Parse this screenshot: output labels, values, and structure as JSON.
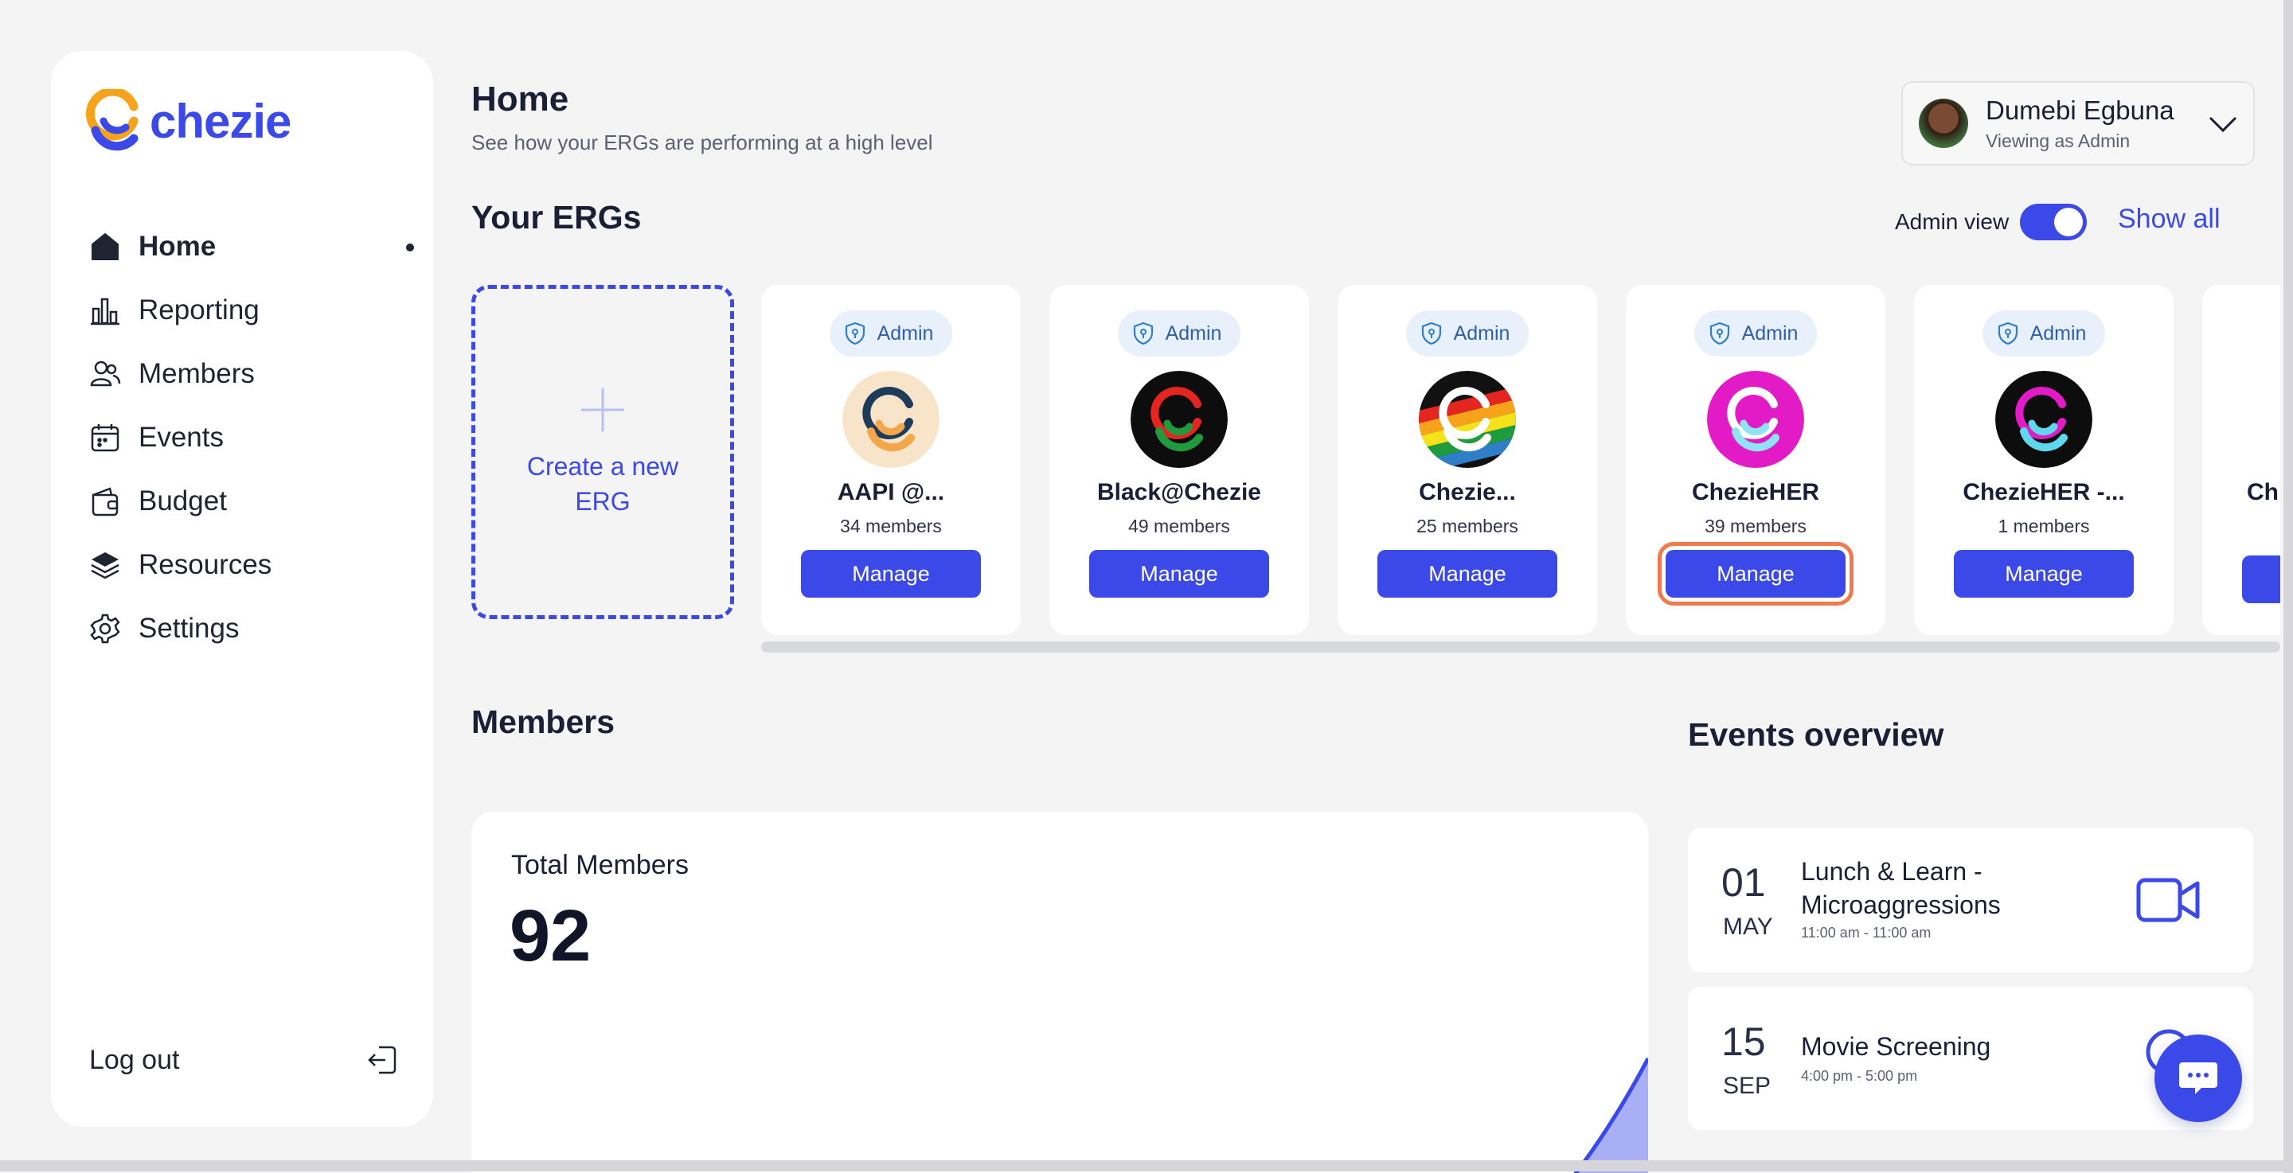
{
  "brand": {
    "name": "chezie",
    "accent": "#3a49e8",
    "logo_orange": "#f7a21b"
  },
  "sidebar": {
    "items": [
      {
        "label": "Home",
        "icon": "home-icon",
        "active": true
      },
      {
        "label": "Reporting",
        "icon": "bar-chart-icon"
      },
      {
        "label": "Members",
        "icon": "users-icon"
      },
      {
        "label": "Events",
        "icon": "calendar-icon"
      },
      {
        "label": "Budget",
        "icon": "wallet-icon"
      },
      {
        "label": "Resources",
        "icon": "layers-icon"
      },
      {
        "label": "Settings",
        "icon": "gear-icon"
      }
    ],
    "logout_label": "Log out"
  },
  "header": {
    "title": "Home",
    "subtitle": "See how your ERGs are performing at a high level"
  },
  "user": {
    "name": "Dumebi Egbuna",
    "role": "Viewing as Admin"
  },
  "ergs": {
    "title": "Your ERGs",
    "admin_view_label": "Admin view",
    "admin_view_on": true,
    "show_all": "Show all",
    "create_label": "Create a new ERG",
    "badge_label": "Admin",
    "manage_label": "Manage",
    "cards": [
      {
        "name": "AAPI @...",
        "members": "34 members",
        "logo": "aapi-logo"
      },
      {
        "name": "Black@Chezie",
        "members": "49 members",
        "logo": "black-logo"
      },
      {
        "name": "Chezie...",
        "members": "25 members",
        "logo": "pride-logo"
      },
      {
        "name": "ChezieHER",
        "members": "39 members",
        "logo": "her-logo",
        "focused": true
      },
      {
        "name": "ChezieHER -...",
        "members": "1 members",
        "logo": "her-dark-logo"
      },
      {
        "name": "Ch",
        "members": "",
        "logo": "partial-logo"
      }
    ]
  },
  "members": {
    "title": "Members",
    "total_label": "Total Members",
    "total_value": "92"
  },
  "events": {
    "title": "Events overview",
    "items": [
      {
        "day": "01",
        "month": "MAY",
        "title": "Lunch & Learn - Microaggressions",
        "time": "11:00 am - 11:00 am",
        "icon": "video-icon"
      },
      {
        "day": "15",
        "month": "SEP",
        "title": "Movie Screening",
        "time": "4:00 pm - 5:00 pm",
        "icon": "location-icon"
      }
    ]
  }
}
